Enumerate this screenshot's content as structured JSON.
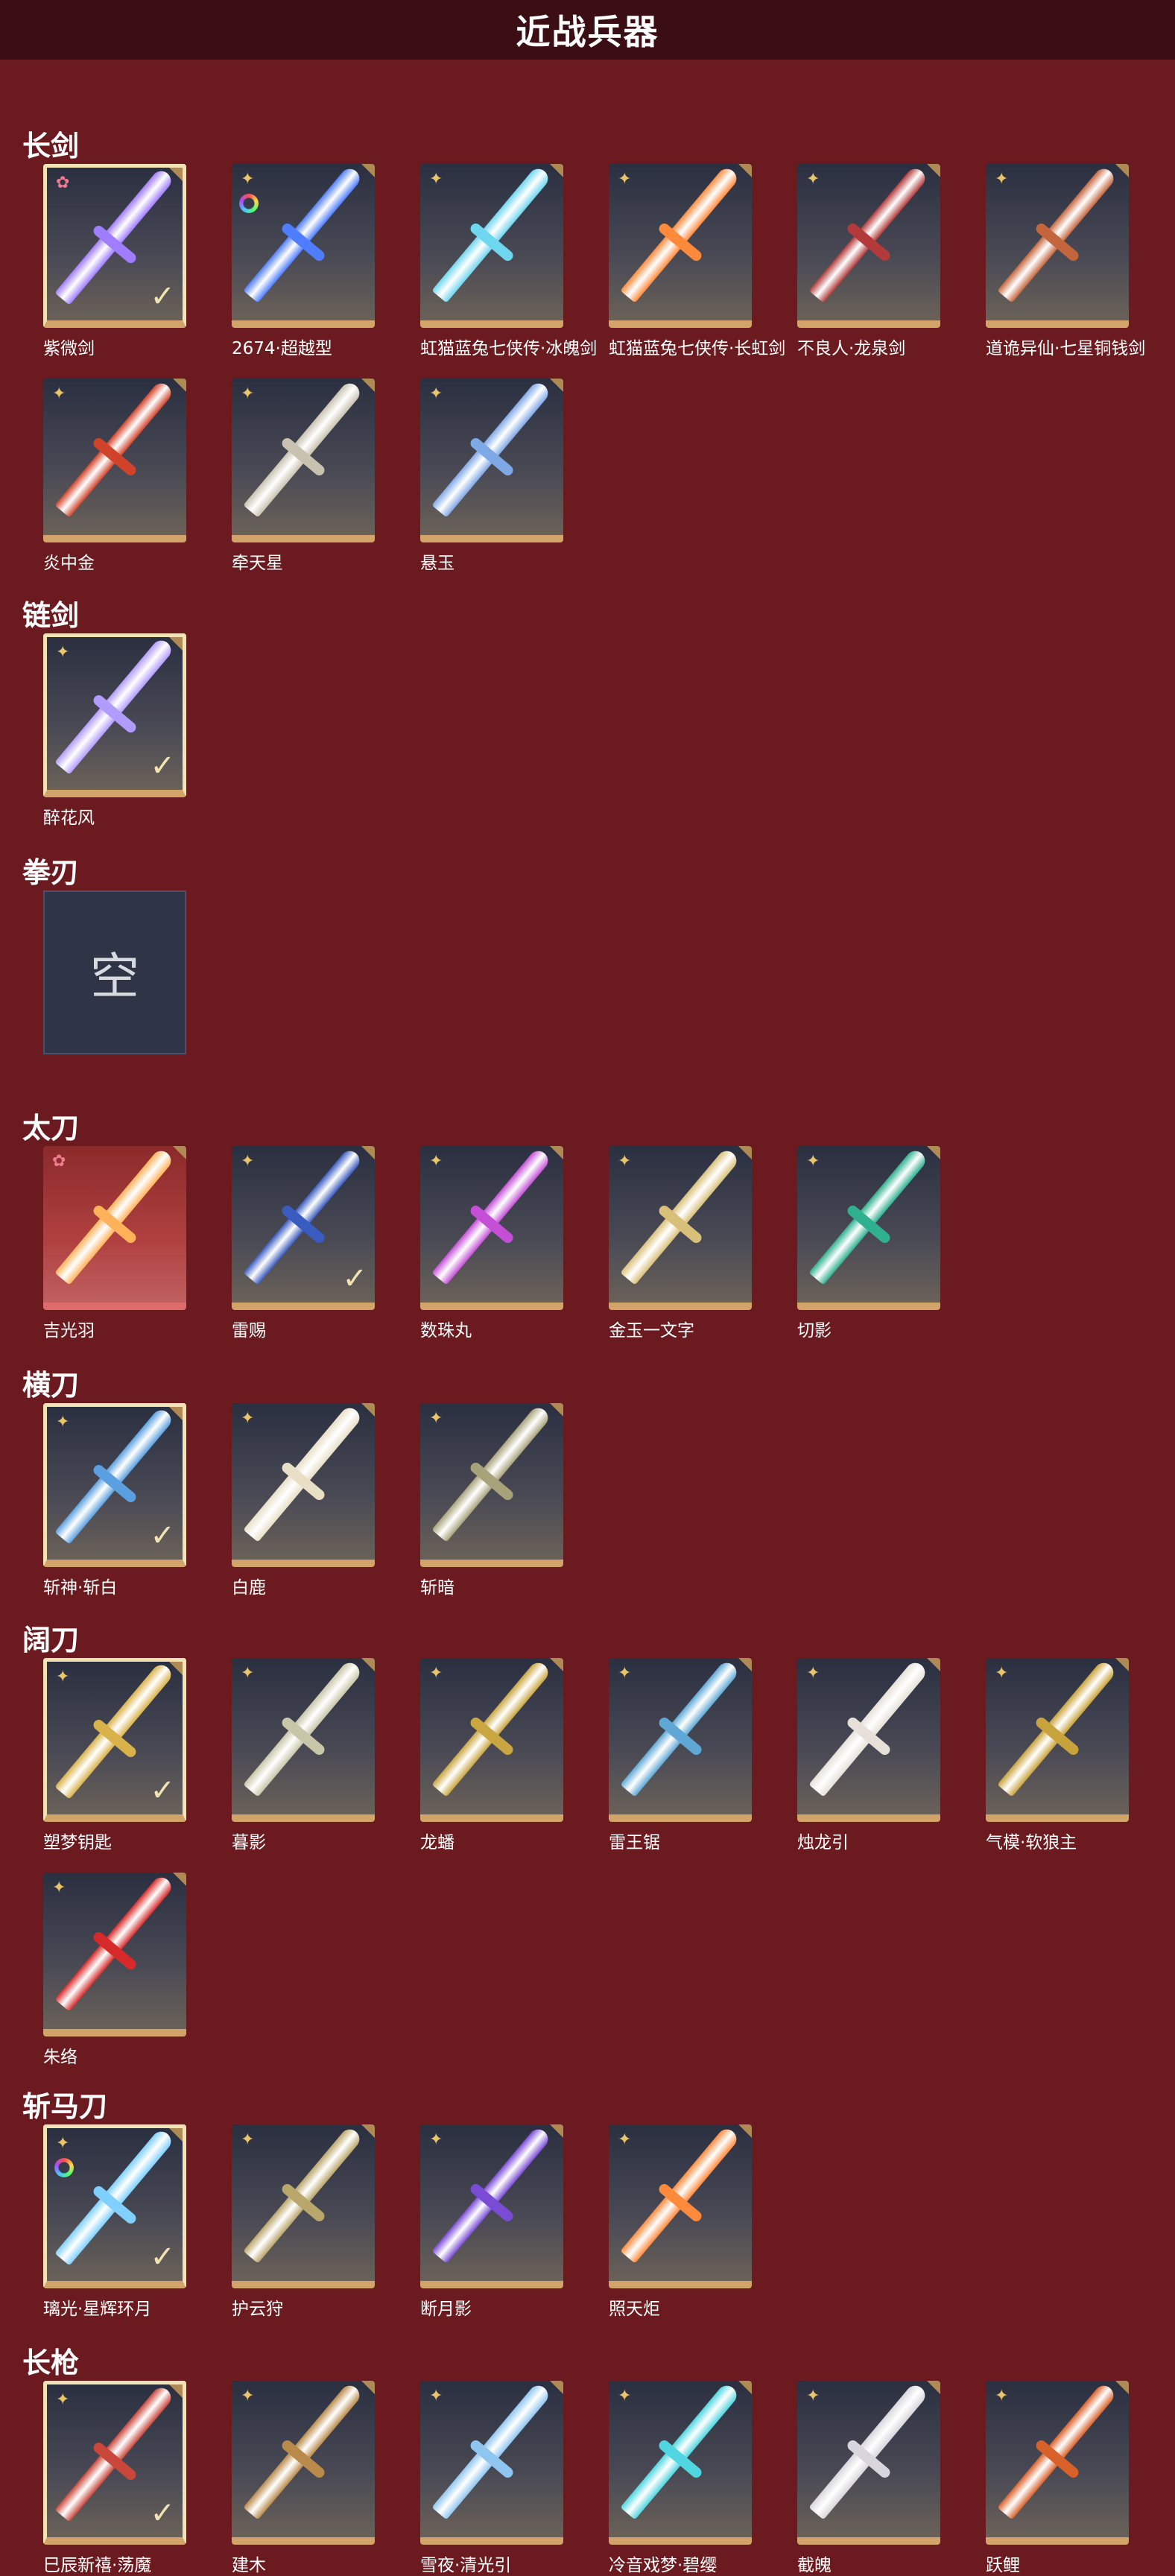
{
  "page": {
    "title": "近战兵器"
  },
  "categories": [
    {
      "title": "长剑",
      "items": [
        {
          "name": "紫微剑",
          "rarity": "pink",
          "selected": true,
          "ring": false,
          "color": "#a07cff"
        },
        {
          "name": "2674·超越型",
          "rarity": "gold",
          "selected": false,
          "ring": true,
          "color": "#4f7dff"
        },
        {
          "name": "虹猫蓝兔七侠传·冰魄剑",
          "rarity": "gold",
          "selected": false,
          "ring": false,
          "color": "#6fd6f0"
        },
        {
          "name": "虹猫蓝兔七侠传·长虹剑",
          "rarity": "gold",
          "selected": false,
          "ring": false,
          "color": "#ff8a3c"
        },
        {
          "name": "不良人·龙泉剑",
          "rarity": "gold",
          "selected": false,
          "ring": false,
          "color": "#b23a3a"
        },
        {
          "name": "道诡异仙·七星铜钱剑",
          "rarity": "gold",
          "selected": false,
          "ring": false,
          "color": "#c4663d"
        },
        {
          "name": "炎中金",
          "rarity": "gold",
          "selected": false,
          "ring": false,
          "color": "#d0432a"
        },
        {
          "name": "牵天星",
          "rarity": "gold",
          "selected": false,
          "ring": false,
          "color": "#c9c2b0"
        },
        {
          "name": "悬玉",
          "rarity": "gold",
          "selected": false,
          "ring": false,
          "color": "#7fa8e6"
        }
      ]
    },
    {
      "title": "链剑",
      "items": [
        {
          "name": "醉花风",
          "rarity": "gold",
          "selected": true,
          "ring": false,
          "color": "#b29bff"
        }
      ]
    },
    {
      "title": "拳刃",
      "items": [
        {
          "name": "",
          "empty": true,
          "empty_text": "空"
        }
      ]
    },
    {
      "title": "太刀",
      "items": [
        {
          "name": "吉光羽",
          "rarity": "pink",
          "selected": false,
          "ring": false,
          "red": true,
          "color": "#ffb25a"
        },
        {
          "name": "雷赐",
          "rarity": "gold",
          "selected": false,
          "ring": false,
          "check": true,
          "color": "#3a5bbf"
        },
        {
          "name": "数珠丸",
          "rarity": "gold",
          "selected": false,
          "ring": false,
          "color": "#c44fd6"
        },
        {
          "name": "金玉一文字",
          "rarity": "gold",
          "selected": false,
          "ring": false,
          "color": "#d9c07a"
        },
        {
          "name": "切影",
          "rarity": "gold",
          "selected": false,
          "ring": false,
          "color": "#2fb08f"
        }
      ]
    },
    {
      "title": "横刀",
      "items": [
        {
          "name": "斩神·斩白",
          "rarity": "gold",
          "selected": true,
          "ring": false,
          "color": "#5aa0e0"
        },
        {
          "name": "白鹿",
          "rarity": "gold",
          "selected": false,
          "ring": false,
          "color": "#e8dfc6"
        },
        {
          "name": "斩暗",
          "rarity": "gold",
          "selected": false,
          "ring": false,
          "color": "#a8a27a"
        }
      ]
    },
    {
      "title": "阔刀",
      "items": [
        {
          "name": "塑梦钥匙",
          "rarity": "gold",
          "selected": true,
          "ring": false,
          "color": "#d9b24a"
        },
        {
          "name": "暮影",
          "rarity": "gold",
          "selected": false,
          "ring": false,
          "color": "#c8c6a8"
        },
        {
          "name": "龙蟠",
          "rarity": "gold",
          "selected": false,
          "ring": false,
          "color": "#c9a640"
        },
        {
          "name": "雷王锯",
          "rarity": "gold",
          "selected": false,
          "ring": false,
          "color": "#5fa8d6"
        },
        {
          "name": "烛龙引",
          "rarity": "gold",
          "selected": false,
          "ring": false,
          "color": "#e6e0d8"
        },
        {
          "name": "气模·软狼主",
          "rarity": "gold",
          "selected": false,
          "ring": false,
          "color": "#c8a23a"
        },
        {
          "name": "朱络",
          "rarity": "gold",
          "selected": false,
          "ring": false,
          "color": "#d62a2a"
        }
      ]
    },
    {
      "title": "斩马刀",
      "items": [
        {
          "name": "璃光·星辉环月",
          "rarity": "gold",
          "selected": true,
          "ring": true,
          "color": "#7fd0ff"
        },
        {
          "name": "护云狩",
          "rarity": "gold",
          "selected": false,
          "ring": false,
          "color": "#b9a66a"
        },
        {
          "name": "断月影",
          "rarity": "gold",
          "selected": false,
          "ring": false,
          "color": "#7a4cd6"
        },
        {
          "name": "照天炬",
          "rarity": "gold",
          "selected": false,
          "ring": false,
          "color": "#ff8a3c"
        }
      ]
    },
    {
      "title": "长枪",
      "items": [
        {
          "name": "巳辰新禧·荡魔",
          "rarity": "gold",
          "selected": true,
          "ring": false,
          "color": "#c8463a"
        },
        {
          "name": "建木",
          "rarity": "gold",
          "selected": false,
          "ring": false,
          "color": "#b98a4a"
        },
        {
          "name": "雪夜·清光引",
          "rarity": "gold",
          "selected": false,
          "ring": false,
          "color": "#8fc6f0"
        },
        {
          "name": "冷音戏梦·碧缨",
          "rarity": "gold",
          "selected": false,
          "ring": false,
          "color": "#4fd6e0"
        },
        {
          "name": "截魄",
          "rarity": "gold",
          "selected": false,
          "ring": false,
          "color": "#d8d6dc"
        },
        {
          "name": "跃鲤",
          "rarity": "gold",
          "selected": false,
          "ring": false,
          "color": "#d8612a"
        }
      ]
    }
  ]
}
